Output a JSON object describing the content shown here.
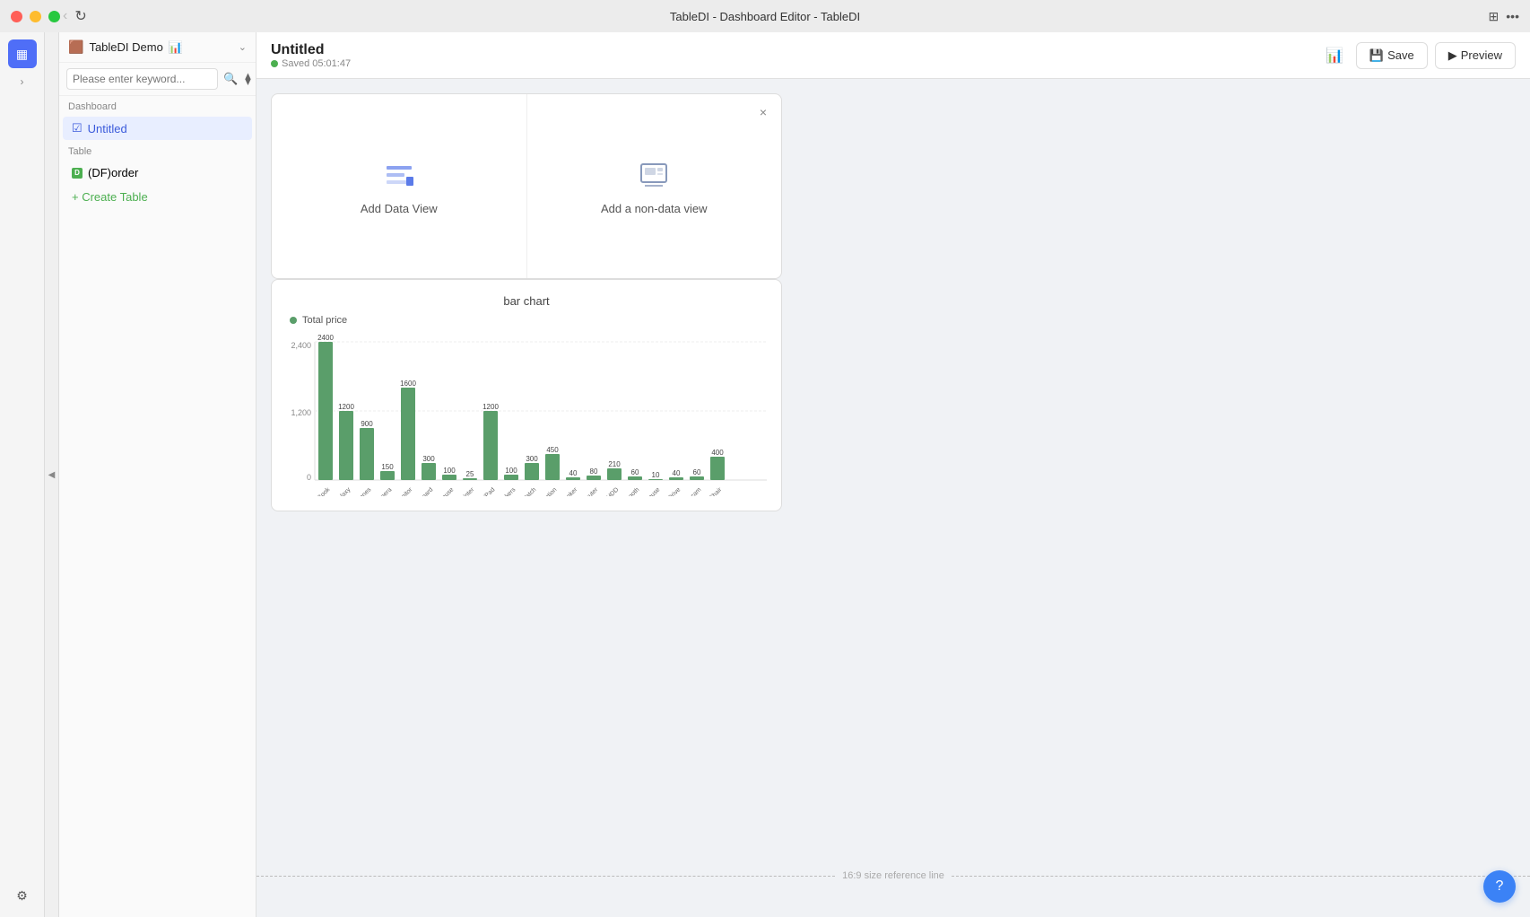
{
  "window": {
    "title": "TableDI - Dashboard Editor - TableDI"
  },
  "titlebar": {
    "back_disabled": true,
    "forward_enabled": false
  },
  "sidebar": {
    "db_name": "TableDI Demo",
    "db_emoji": "📊",
    "search_placeholder": "Please enter keyword...",
    "dashboard_section": "Dashboard",
    "dashboard_items": [
      {
        "label": "Untitled",
        "active": true
      }
    ],
    "table_section": "Table",
    "table_items": [
      {
        "label": "(DF)order",
        "icon": "🟢"
      }
    ],
    "create_table_label": "+ Create Table"
  },
  "toolbar": {
    "title": "Untitled",
    "saved_status": "Saved 05:01:47",
    "save_label": "Save",
    "preview_label": "Preview"
  },
  "add_view_panel": {
    "close_label": "×",
    "data_view_label": "Add Data View",
    "non_data_view_label": "Add a non-data view"
  },
  "chart": {
    "title": "bar chart",
    "legend_label": "Total price",
    "bars": [
      {
        "label": "Apple MacBook",
        "value": 2400,
        "display": "2400"
      },
      {
        "label": "Samsung Galaxy",
        "value": 1200,
        "display": "1,200"
      },
      {
        "label": "Sony Headphones",
        "value": 900,
        "display": "900"
      },
      {
        "label": "Nikon Camera",
        "value": 150,
        "display": "150"
      },
      {
        "label": "Dell Monitor",
        "value": 1600,
        "display": "1600"
      },
      {
        "label": "Logitech Keyboard",
        "value": 300,
        "display": "300"
      },
      {
        "label": "HP Mouse",
        "value": 100,
        "display": "100"
      },
      {
        "label": "HP Printer",
        "value": 25,
        "display": "25"
      },
      {
        "label": "Apple iPad",
        "value": 1200,
        "display": "1200"
      },
      {
        "label": "JBL Speakers",
        "value": 100,
        "display": "100"
      },
      {
        "label": "Apple Watch",
        "value": 300,
        "display": "300"
      },
      {
        "label": "Sony PlayStation",
        "value": 450,
        "display": "450"
      },
      {
        "label": "Sony Anker",
        "value": 40,
        "display": "40"
      },
      {
        "label": "TP-Link Router",
        "value": 80,
        "display": "80"
      },
      {
        "label": "Seagate Ext. HDD",
        "value": 210,
        "display": "210"
      },
      {
        "label": "Jabra Bluetooth",
        "value": 60,
        "display": "60"
      },
      {
        "label": "Microsoft Mouse",
        "value": 10,
        "display": "10"
      },
      {
        "label": "SanDisk USB Drive",
        "value": 40,
        "display": "40"
      },
      {
        "label": "Logitech Webcam",
        "value": 60,
        "display": "60"
      },
      {
        "label": "DXRacer Gaming Chair",
        "value": 400,
        "display": "400"
      }
    ],
    "y_labels": [
      "0",
      "1,200",
      "2,400"
    ]
  },
  "reference_line": {
    "label": "16:9 size reference line"
  },
  "help_btn_label": "?"
}
